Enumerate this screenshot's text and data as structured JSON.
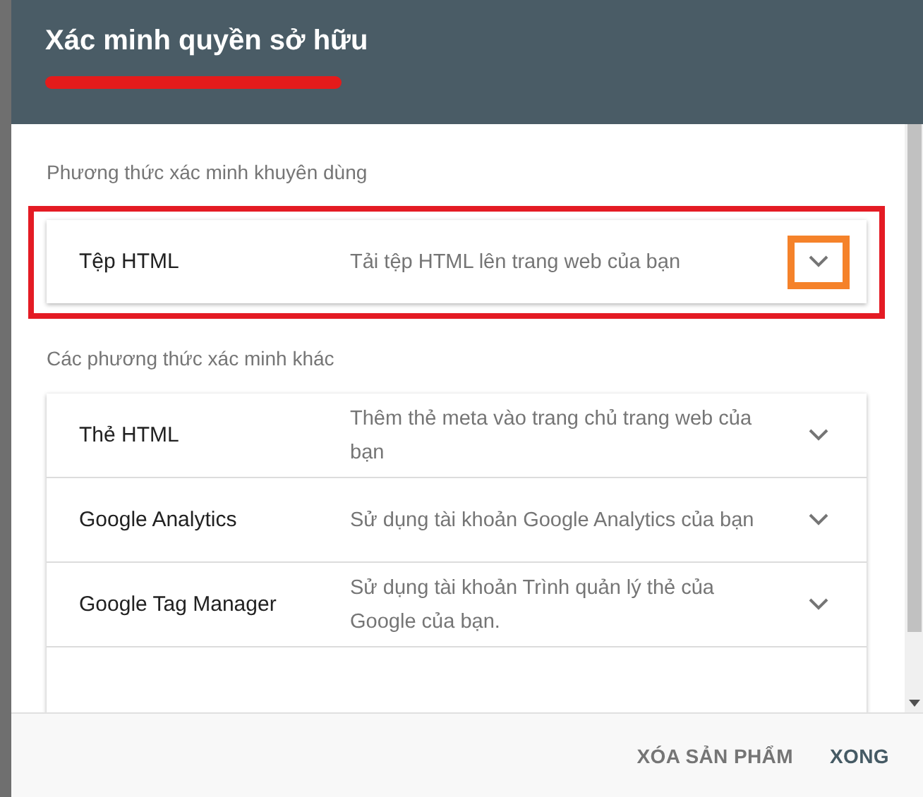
{
  "dialog": {
    "title": "Xác minh quyền sở hữu",
    "url_redacted": true
  },
  "recommended": {
    "heading": "Phương thức xác minh khuyên dùng",
    "methods": [
      {
        "name": "Tệp HTML",
        "description": "Tải tệp HTML lên trang web của bạn",
        "expanded": false,
        "highlighted": true
      }
    ]
  },
  "other": {
    "heading": "Các phương thức xác minh khác",
    "methods": [
      {
        "name": "Thẻ HTML",
        "description": "Thêm thẻ meta vào trang chủ trang web của bạn",
        "expanded": false,
        "highlighted": false
      },
      {
        "name": "Google Analytics",
        "description": "Sử dụng tài khoản Google Analytics của bạn",
        "expanded": false,
        "highlighted": false
      },
      {
        "name": "Google Tag Manager",
        "description": "Sử dụng tài khoản Trình quản lý thẻ của Google của bạn.",
        "expanded": false,
        "highlighted": false
      }
    ]
  },
  "buttons": [
    {
      "label": "XÓA SẢN PHẨM",
      "kind": "secondary"
    },
    {
      "label": "XONG",
      "kind": "primary"
    }
  ]
}
